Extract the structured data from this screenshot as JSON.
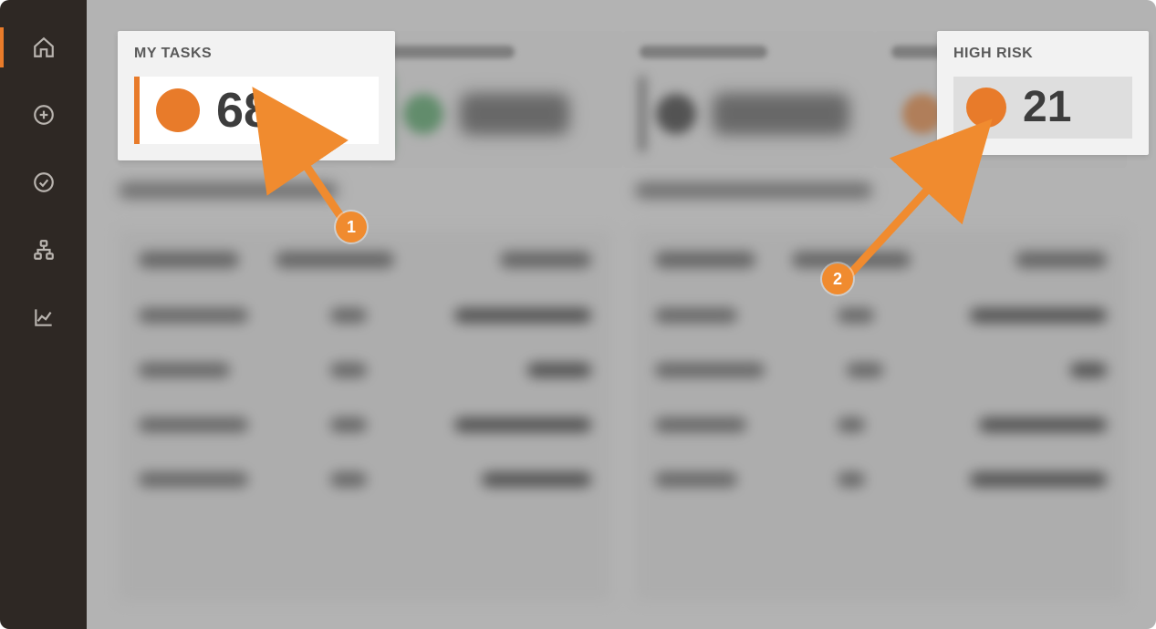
{
  "sidebar": {
    "items": [
      {
        "name": "home-icon",
        "active": true
      },
      {
        "name": "add-icon",
        "active": false
      },
      {
        "name": "check-icon",
        "active": false
      },
      {
        "name": "network-icon",
        "active": false
      },
      {
        "name": "chart-icon",
        "active": false
      }
    ]
  },
  "stat_cards": {
    "my_tasks": {
      "label": "MY TASKS",
      "value": "68",
      "color": "#e87b2a"
    },
    "card2": {
      "value": "36K",
      "color": "#3c9a52"
    },
    "card3": {
      "value": "25.1K",
      "color": "#1c1c1c"
    },
    "high_risk": {
      "label": "HIGH RISK",
      "value": "21",
      "color": "#e87b2a"
    }
  },
  "callouts": {
    "one": "1",
    "two": "2"
  }
}
